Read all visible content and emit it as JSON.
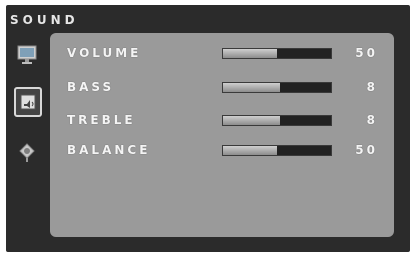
{
  "menu": {
    "title": "SOUND"
  },
  "sidebar": {
    "icons": [
      {
        "name": "picture-icon",
        "active": false
      },
      {
        "name": "sound-icon",
        "active": true
      },
      {
        "name": "setup-icon",
        "active": false
      }
    ]
  },
  "settings": [
    {
      "label": "VOLUME",
      "value": "50",
      "level": 0.5
    },
    {
      "label": "BASS",
      "value": "8",
      "level": 0.53
    },
    {
      "label": "TREBLE",
      "value": "8",
      "level": 0.53
    },
    {
      "label": "BALANCE",
      "value": "50",
      "level": 0.5
    }
  ],
  "colors": {
    "screen_bg": "#2b2b2b",
    "panel_bg": "#9a9a9a",
    "text": "#f4f4f4",
    "bar_track": "#222222",
    "bar_fill": "#bdbdbd"
  }
}
